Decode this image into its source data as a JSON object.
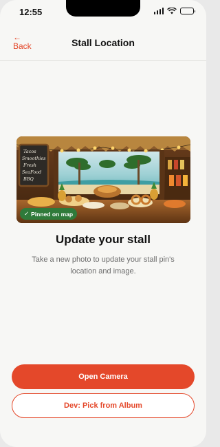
{
  "status_bar": {
    "time": "12:55"
  },
  "nav": {
    "back_arrow": "←",
    "back_label": "Back",
    "title": "Stall Location"
  },
  "stall": {
    "badge_check": "✓",
    "badge_label": "Pinned on map",
    "menu_board": [
      "Tacos",
      "Smoothies",
      "Fresh",
      "SeaFood",
      "BBQ"
    ]
  },
  "content": {
    "heading": "Update your stall",
    "description": "Take a new photo to update your stall pin's location and image."
  },
  "actions": {
    "primary_label": "Open Camera",
    "secondary_label": "Dev: Pick from Album"
  },
  "colors": {
    "accent": "#e4482a",
    "badge": "#2f7a3a"
  }
}
